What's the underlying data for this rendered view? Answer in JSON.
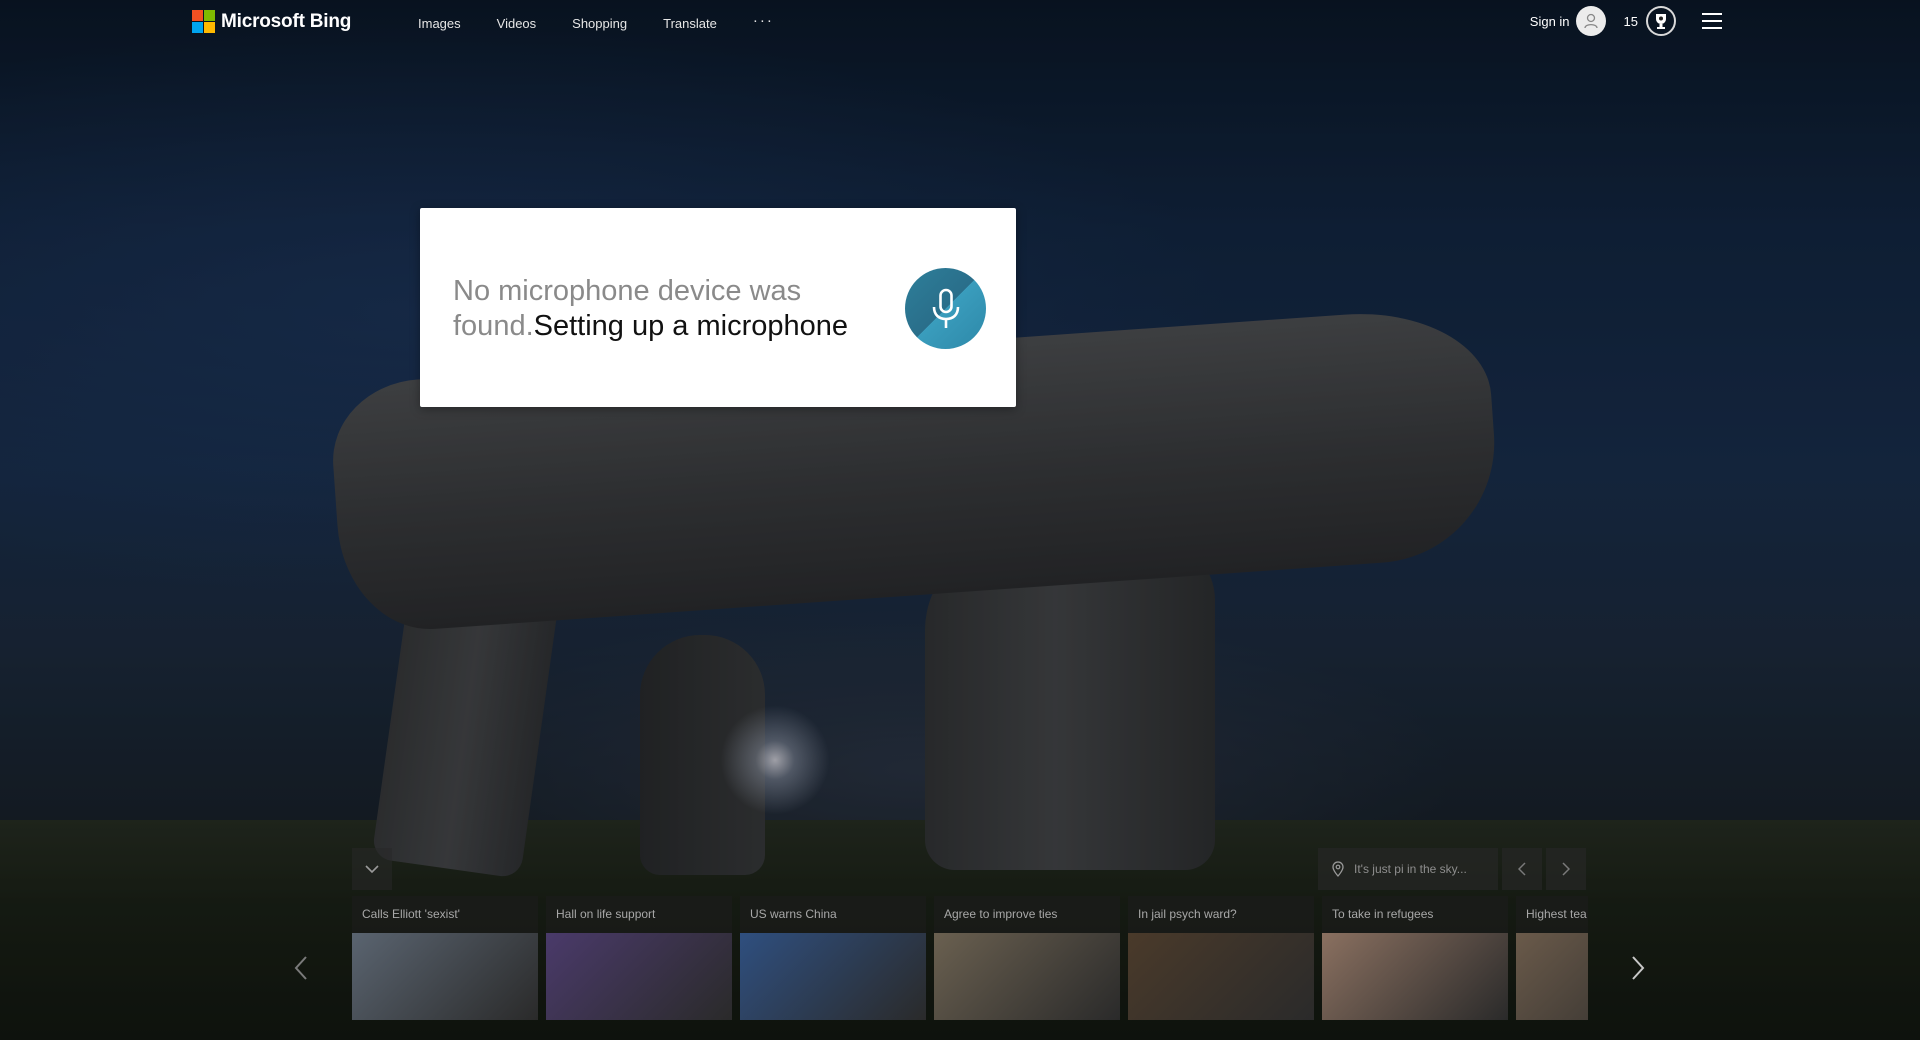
{
  "header": {
    "logo_text": "Microsoft Bing",
    "logo_colors": [
      "#f25022",
      "#7fba00",
      "#00a4ef",
      "#ffb900"
    ],
    "nav": [
      {
        "label": "Images"
      },
      {
        "label": "Videos"
      },
      {
        "label": "Shopping"
      },
      {
        "label": "Translate"
      }
    ],
    "more_label": "···",
    "signin_label": "Sign in",
    "points": "15",
    "avatar_icon": "user-icon",
    "reward_icon": "trophy-icon",
    "menu_icon": "hamburger-icon"
  },
  "mic_dialog": {
    "message_gray": "No microphone device was found.",
    "message_link": "Setting up a microphone",
    "mic_icon": "microphone-icon",
    "accent": "#2d88a8"
  },
  "news_bar": {
    "collapse_icon": "chevron-down-icon",
    "location_icon": "location-pin-icon",
    "location_text": "It's just pi in the sky...",
    "cards": [
      {
        "title": "Calls Elliott 'sexist'",
        "thumb_color": "#5a6470"
      },
      {
        "title": "Hall on life support",
        "thumb_color": "#4a3a6a"
      },
      {
        "title": "US warns China",
        "thumb_color": "#2f4f7f"
      },
      {
        "title": "Agree to improve ties",
        "thumb_color": "#6a6050"
      },
      {
        "title": "In jail psych ward?",
        "thumb_color": "#4a3a2a"
      },
      {
        "title": "To take in refugees",
        "thumb_color": "#8a7060"
      },
      {
        "title": "Highest tea",
        "thumb_color": "#6a5a4a"
      }
    ]
  }
}
